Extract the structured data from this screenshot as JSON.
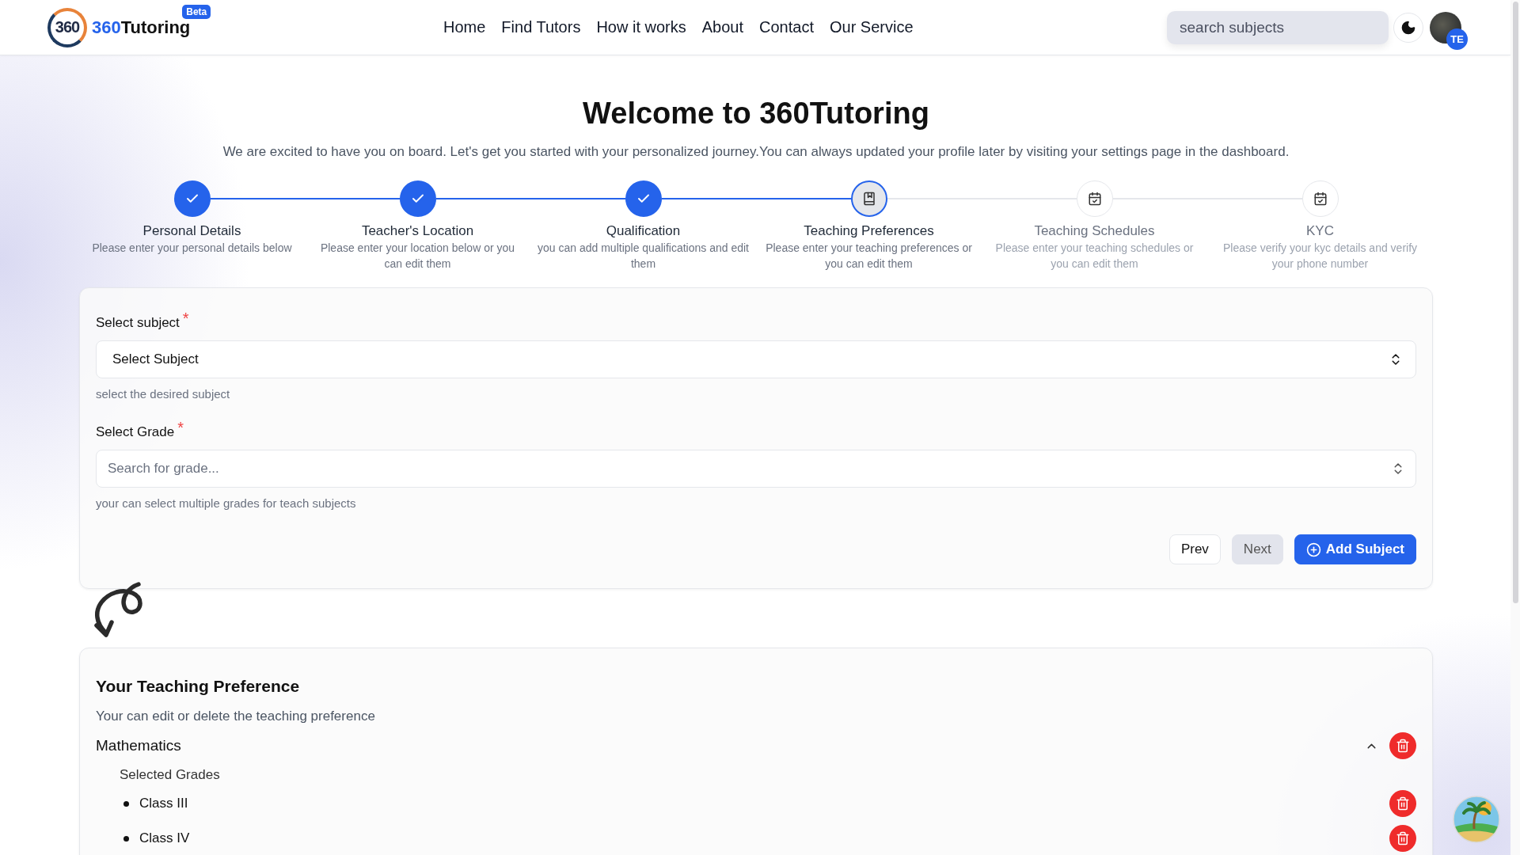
{
  "header": {
    "logo": {
      "mark": "360",
      "name_accent": "360",
      "name_rest": "Tutoring",
      "badge": "Beta"
    },
    "nav": [
      "Home",
      "Find Tutors",
      "How it works",
      "About",
      "Contact",
      "Our Service"
    ],
    "search": {
      "placeholder": "search subjects"
    },
    "user": {
      "initials": "TE"
    }
  },
  "intro": {
    "title": "Welcome to 360Tutoring",
    "subtitle": "We are excited to have you on board. Let's get you started with your personalized journey.You can always updated your profile later by visiting your settings page in the dashboard."
  },
  "steps": [
    {
      "title": "Personal Details",
      "description": "Please enter your personal details below",
      "completed": true,
      "selected": false
    },
    {
      "title": "Teacher's Location",
      "description": "Please enter your location below or you can edit them",
      "completed": true,
      "selected": false
    },
    {
      "title": "Qualification",
      "description": "you can add multiple qualifications and edit them",
      "completed": true,
      "selected": false
    },
    {
      "title": "Teaching Preferences",
      "description": "Please enter your teaching preferences or you can edit them",
      "completed": false,
      "selected": true
    },
    {
      "title": "Teaching Schedules",
      "description": "Please enter your teaching schedules or you can edit them",
      "completed": false,
      "selected": false
    },
    {
      "title": "KYC",
      "description": "Please verify your kyc details and verify your phone number",
      "completed": false,
      "selected": false
    }
  ],
  "subject_form": {
    "fields": [
      {
        "kind": "select",
        "label": "Select subject",
        "required_mark": "*",
        "value": "Select Subject",
        "helper": "select the desired subject"
      },
      {
        "kind": "search",
        "label": "Select Grade",
        "required_mark": "*",
        "placeholder": "Search for grade...",
        "helper": "your can select multiple grades for teach subjects"
      }
    ],
    "buttons": [
      {
        "label": "Prev",
        "kind": "outline",
        "disabled": false
      },
      {
        "label": "Next",
        "kind": "outline",
        "disabled": true
      },
      {
        "label": "Add Subject",
        "kind": "primary",
        "disabled": false
      }
    ]
  },
  "preferences": {
    "title": "Your Teaching Preference",
    "subtitle": "Your can edit or delete the teaching preference",
    "subjects": [
      {
        "name": "Mathematics",
        "expanded": true,
        "grades_label": "Selected Grades",
        "grades": [
          "Class III",
          "Class IV"
        ]
      }
    ]
  }
}
